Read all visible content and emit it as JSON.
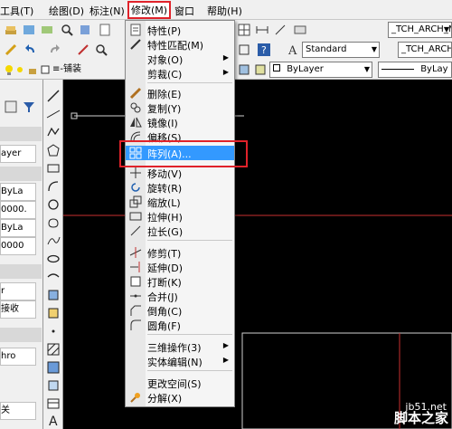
{
  "menubar": {
    "items": [
      {
        "label": "工具(T)"
      },
      {
        "label": "绘图(D)"
      },
      {
        "label": "标注(N)"
      },
      {
        "label": "修改(M)"
      },
      {
        "label": "窗口"
      },
      {
        "label": "帮助(H)"
      }
    ]
  },
  "toolbar": {
    "textstyle_value": "Standard",
    "arch_combo_1": "_TCH_ARCH_M_M",
    "arch_combo_2": "_TCH_ARCH_M_M",
    "layer_value": "≡-铺装",
    "color_value": "ByLayer",
    "linetype_value": "ByLay"
  },
  "left_palette": {
    "cells": [
      "ayer",
      "ByLa",
      "0000.",
      "ByLa",
      "0000",
      "r",
      "接收",
      "hro",
      "关"
    ]
  },
  "modify_menu": {
    "items": [
      {
        "label": "特性(P)",
        "icon": "properties-icon"
      },
      {
        "label": "特性匹配(M)",
        "icon": "match-properties-icon"
      },
      {
        "label": "对象(O)",
        "submenu": true
      },
      {
        "label": "剪裁(C)",
        "submenu": true
      },
      {
        "label": "删除(E)",
        "icon": "erase-icon"
      },
      {
        "label": "复制(Y)",
        "icon": "copy-icon"
      },
      {
        "label": "镜像(I)",
        "icon": "mirror-icon"
      },
      {
        "label": "偏移(S)",
        "icon": "offset-icon"
      },
      {
        "label": "阵列(A)...",
        "icon": "array-icon",
        "highlighted": true
      },
      {
        "label": "移动(V)",
        "icon": "move-icon"
      },
      {
        "label": "旋转(R)",
        "icon": "rotate-icon"
      },
      {
        "label": "缩放(L)",
        "icon": "scale-icon"
      },
      {
        "label": "拉伸(H)",
        "icon": "stretch-icon"
      },
      {
        "label": "拉长(G)",
        "icon": "lengthen-icon"
      },
      {
        "label": "修剪(T)",
        "icon": "trim-icon"
      },
      {
        "label": "延伸(D)",
        "icon": "extend-icon"
      },
      {
        "label": "打断(K)",
        "icon": "break-icon"
      },
      {
        "label": "合并(J)",
        "icon": "join-icon"
      },
      {
        "label": "倒角(C)",
        "icon": "chamfer-icon"
      },
      {
        "label": "圆角(F)",
        "icon": "fillet-icon"
      },
      {
        "label": "三维操作(3)",
        "submenu": true
      },
      {
        "label": "实体编辑(N)",
        "submenu": true
      },
      {
        "label": "更改空间(S)"
      },
      {
        "label": "分解(X)",
        "icon": "explode-icon"
      }
    ]
  },
  "watermark": {
    "site": "jb51.net",
    "name": "脚本之家"
  },
  "colors": {
    "highlight": "#3399ff",
    "annotation_red": "#e0222a",
    "canvas": "#000000"
  }
}
